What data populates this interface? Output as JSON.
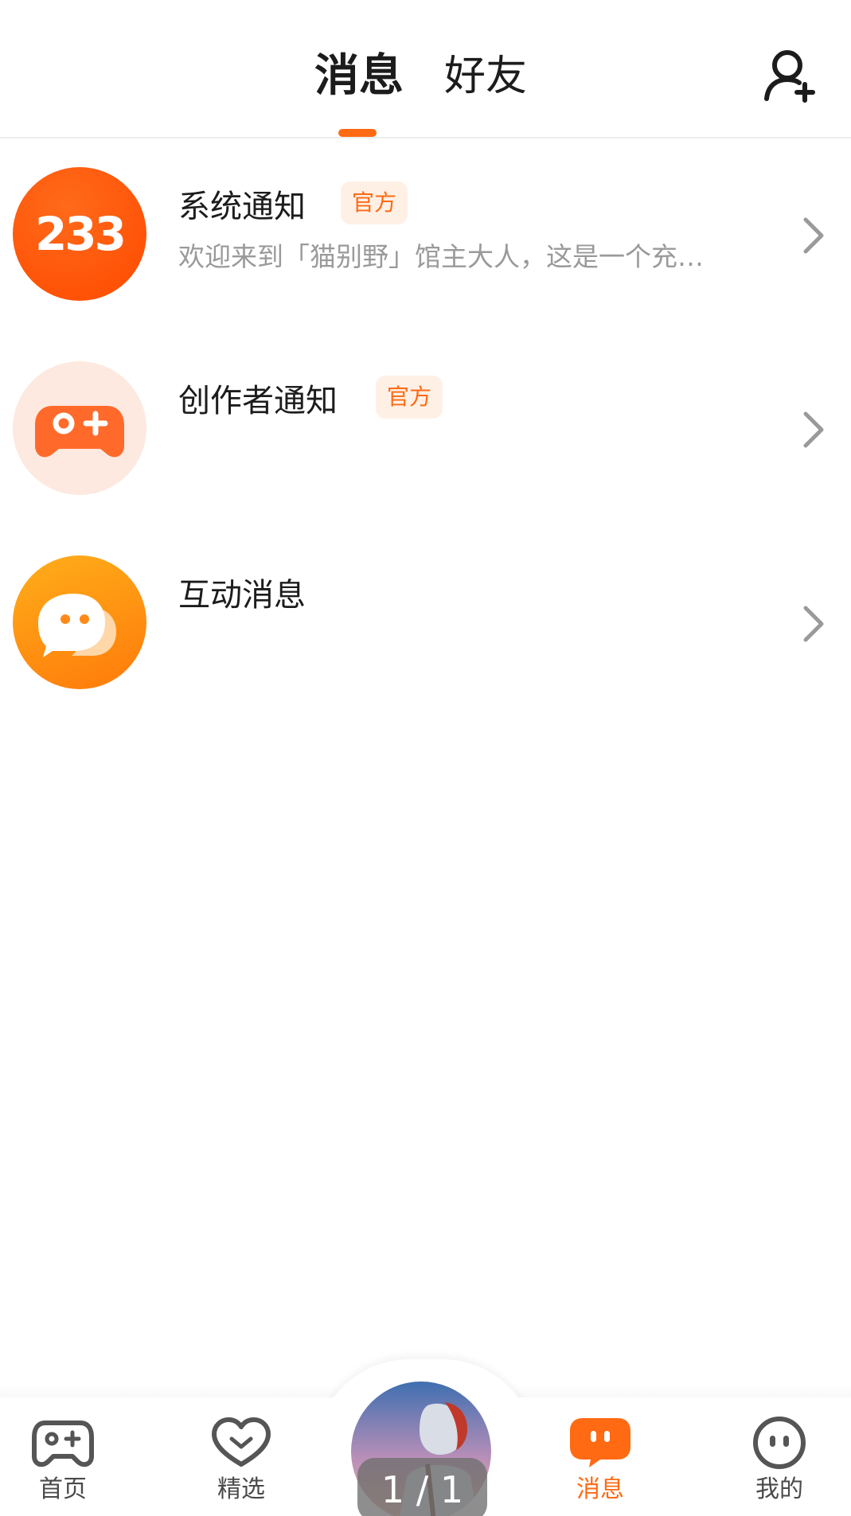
{
  "header": {
    "tabs": [
      {
        "label": "消息",
        "active": true
      },
      {
        "label": "好友",
        "active": false
      }
    ],
    "add_friend_icon": "add-person-icon"
  },
  "colors": {
    "accent": "#ff6a13",
    "badge_bg": "#fff0e6",
    "text_primary": "#1c1c1c",
    "text_secondary": "#9a9a9a"
  },
  "messages": [
    {
      "title": "系统通知",
      "badge": "官方",
      "preview": "欢迎来到「猫别野」馆主大人，这是一个充…",
      "avatar_text": "233",
      "icon": "app-logo-233-icon"
    },
    {
      "title": "创作者通知",
      "badge": "官方",
      "preview": "",
      "icon": "gamepad-icon"
    },
    {
      "title": "互动消息",
      "badge": "",
      "preview": "",
      "icon": "chat-bubble-face-icon"
    }
  ],
  "bottom_nav": {
    "items": [
      {
        "label": "首页",
        "icon": "gamepad-icon",
        "active": false
      },
      {
        "label": "精选",
        "icon": "heart-icon",
        "active": false
      },
      {
        "label": "消息",
        "icon": "message-bubble-icon",
        "active": true
      },
      {
        "label": "我的",
        "icon": "face-icon",
        "active": false
      }
    ],
    "center_avatar_icon": "user-avatar-image",
    "page_counter": "1 / 1"
  }
}
